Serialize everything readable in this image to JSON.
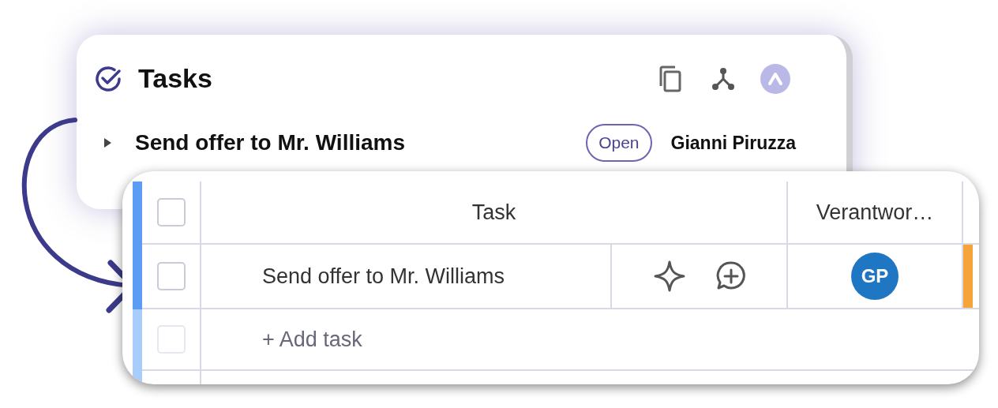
{
  "back_card": {
    "title": "Tasks",
    "task": {
      "title": "Send offer to Mr. Williams",
      "expanded": false,
      "status": "Open",
      "assignee": "Gianni Piruzza"
    }
  },
  "table": {
    "columns": [
      "Task",
      "Verantwor…"
    ],
    "rows": [
      {
        "task": "Send offer to Mr. Williams",
        "checked": false,
        "avatar": "GP",
        "color": "#f5a43a"
      }
    ],
    "add_task": "+ Add task",
    "header_checked": false,
    "add_row_checkbox": {
      "checked": false,
      "disabled": true
    }
  }
}
